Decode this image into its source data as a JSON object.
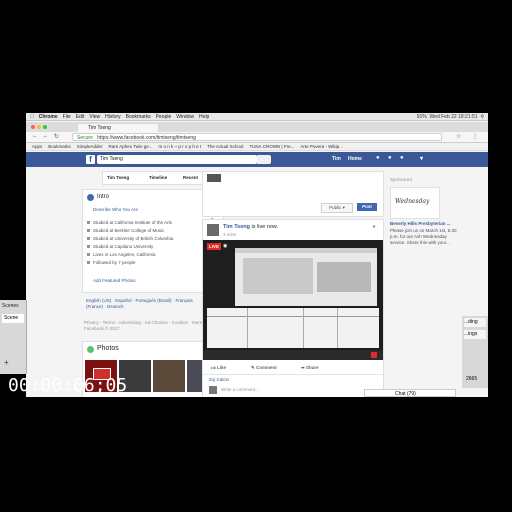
{
  "mac_menu": [
    "Chrome",
    "File",
    "Edit",
    "View",
    "History",
    "Bookmarks",
    "People",
    "Window",
    "Help"
  ],
  "mac_status": "Wed Feb 22 18:21:51",
  "battery": "91%",
  "tab_title": "Tim Tseng",
  "address": {
    "secure": "Secure",
    "url": "https://www.facebook.com/timtseng/timtseng"
  },
  "bookmarks": [
    "Apps",
    "Bookmarks",
    "SimpleAdder",
    "Rare Aphex Twin ge...",
    "m o n k ~ p r o p h e t",
    "The Actual School",
    "TUNA CROWN | Fre...",
    "Arte Povera - Wikip..."
  ],
  "fb": {
    "search_value": "Tim Tseng",
    "nav_name": "Tim",
    "nav_home": "Home"
  },
  "profile_tabs": {
    "name": "Tim Tseng",
    "timeline": "Timeline",
    "recent": "Recent"
  },
  "intro": {
    "title": "Intro",
    "describe": "Describe Who You Are",
    "rows": [
      "Studied at California Institute of the Arts",
      "Studied at Berklee College of Music",
      "Studied at University of British Columbia",
      "Studied at Capilano University",
      "Lives in Los Angeles, California",
      "Followed by 7 people"
    ],
    "add_photos": "Add Featured Photos"
  },
  "languages": "English (US) · Español · Português (Brasil) · Français (France) · Deutsch",
  "footer": "Privacy · Terms · Advertising · Ad Choices · Cookies · More · Facebook © 2017",
  "photos_title": "Photos",
  "composer": {
    "privacy": "Public",
    "post": "Post"
  },
  "post": {
    "author": "Tim Tseng",
    "status": "is live now.",
    "time": "3 mins",
    "live_badge": "LIVE",
    "like": "Like",
    "comment": "Comment",
    "share": "Share",
    "commenter": "Zoj Calcin",
    "write_comment": "Write a comment..."
  },
  "sponsored": {
    "heading": "Sponsored",
    "ad_word": "Wednesday",
    "ad_title": "Beverly Hills Presbyterian ...",
    "ad_text": "Please join us on March 1st, 6:30 p.m. for our Ash Wednesday service. Share this with your..."
  },
  "chat": "Chat (79)",
  "side_left": {
    "label1": "Scenes",
    "label2": "Scene"
  },
  "side_right": {
    "label1": "...ding",
    "label2": "...ings",
    "number": "2665"
  },
  "timecode": "00:00:06;05",
  "colors": {
    "fb_blue": "#3b5998",
    "live_red": "#e02a2a",
    "secure_green": "#1a8a30"
  }
}
